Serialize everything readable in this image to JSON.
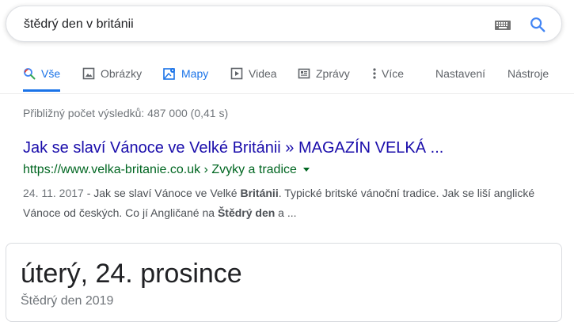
{
  "search": {
    "query": "štědrý den v británii"
  },
  "tabs": [
    {
      "label": "Vše",
      "icon": "search-icon",
      "active": true
    },
    {
      "label": "Obrázky",
      "icon": "image-icon"
    },
    {
      "label": "Mapy",
      "icon": "map-icon"
    },
    {
      "label": "Videa",
      "icon": "play-icon"
    },
    {
      "label": "Zprávy",
      "icon": "news-icon"
    },
    {
      "label": "Více",
      "icon": "more-vert-icon"
    },
    {
      "label": "Nastavení"
    },
    {
      "label": "Nástroje"
    }
  ],
  "stats": "Přibližný počet výsledků: 487 000 (0,41 s)",
  "result": {
    "title": "Jak se slaví Vánoce ve Velké Británii » MAGAZÍN VELKÁ ...",
    "url": "https://www.velka-britanie.co.uk › Zvyky a tradice",
    "snippet": {
      "date": "24. 11. 2017",
      "sep": " - ",
      "t1": "Jak se slaví Vánoce ve Velké ",
      "b1": "Británii",
      "t2": ". Typické britské vánoční tradice. Jak se liší anglické Vánoce od českých. Co jí Angličané na ",
      "b2": "Štědrý den",
      "t3": " a ..."
    }
  },
  "card": {
    "date": "úterý, 24. prosince",
    "subtitle": "Štědrý den 2019"
  },
  "colors": {
    "accent": "#1a73e8",
    "link": "#1a0dab",
    "url": "#006621"
  }
}
